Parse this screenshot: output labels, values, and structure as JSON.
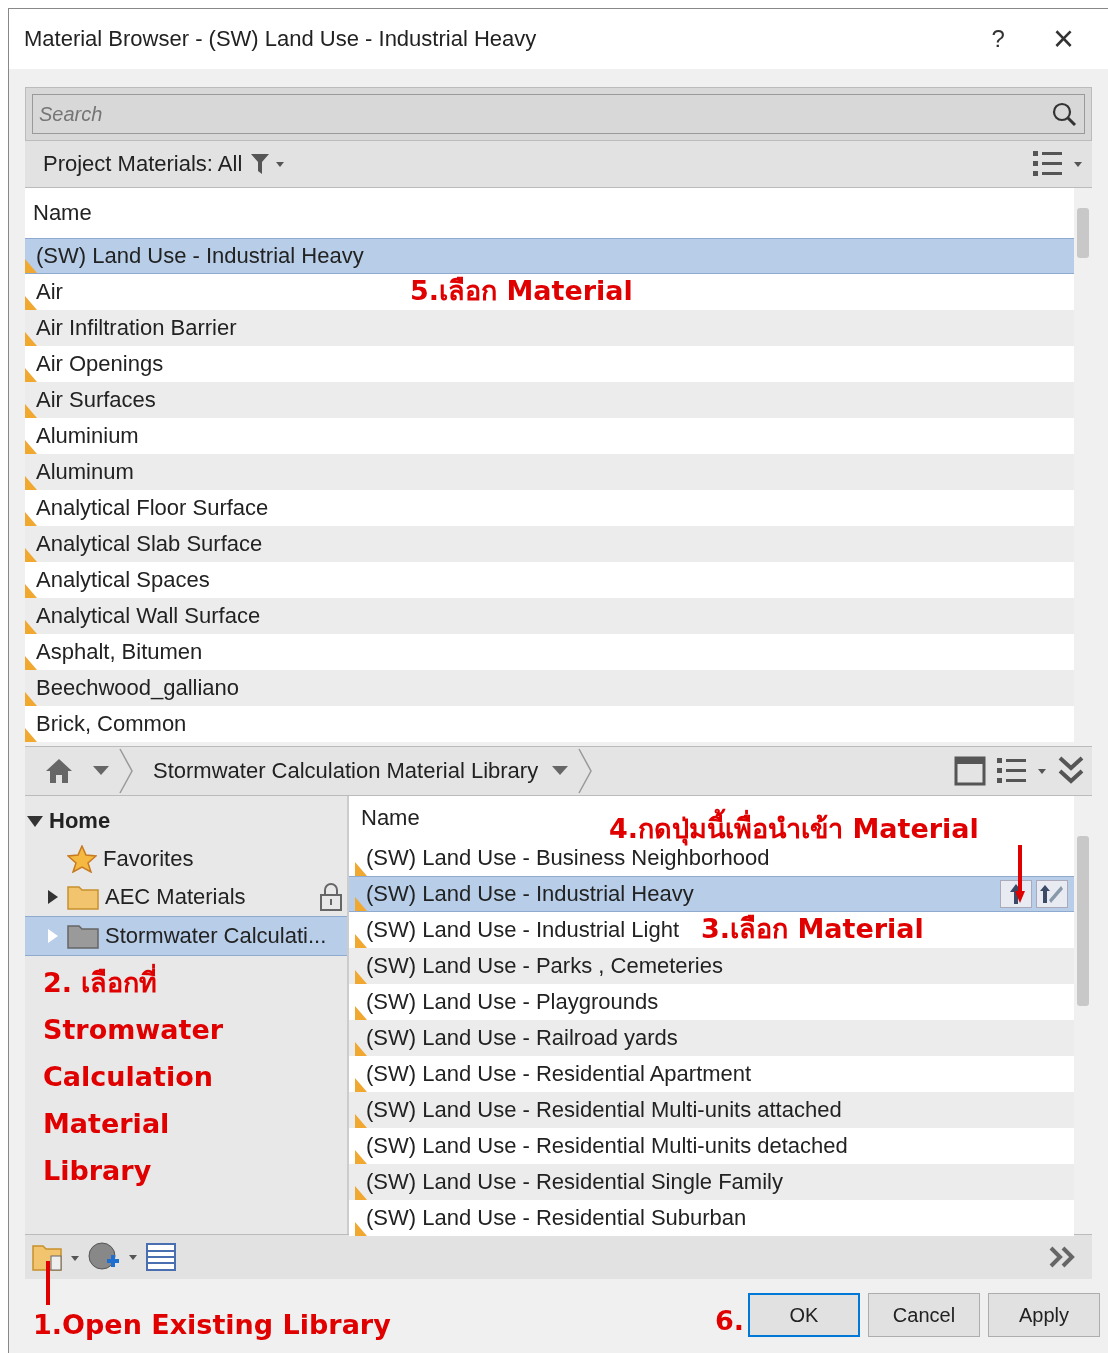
{
  "window": {
    "title": "Material Browser - (SW) Land Use - Industrial Heavy",
    "help": "?",
    "close": "×"
  },
  "search": {
    "placeholder": "Search"
  },
  "filter_bar": {
    "label": "Project Materials: All"
  },
  "project_materials": {
    "column": "Name",
    "rows": [
      {
        "name": "(SW) Land Use - Industrial Heavy",
        "selected": true
      },
      {
        "name": "Air",
        "selected": false
      },
      {
        "name": "Air Infiltration Barrier",
        "selected": false
      },
      {
        "name": "Air Openings",
        "selected": false
      },
      {
        "name": "Air Surfaces",
        "selected": false
      },
      {
        "name": "Aluminium",
        "selected": false
      },
      {
        "name": "Aluminum",
        "selected": false
      },
      {
        "name": "Analytical Floor Surface",
        "selected": false
      },
      {
        "name": "Analytical Slab Surface",
        "selected": false
      },
      {
        "name": "Analytical Spaces",
        "selected": false
      },
      {
        "name": "Analytical Wall Surface",
        "selected": false
      },
      {
        "name": "Asphalt, Bitumen",
        "selected": false
      },
      {
        "name": "Beechwood_galliano",
        "selected": false
      },
      {
        "name": "Brick, Common",
        "selected": false
      }
    ]
  },
  "library_bar": {
    "breadcrumb": "Stormwater Calculation Material Library"
  },
  "tree": [
    {
      "label": "Home",
      "kind": "home",
      "expanded": true,
      "selected": false,
      "children": [
        {
          "label": "Favorites",
          "kind": "favorites",
          "selected": false
        },
        {
          "label": "AEC Materials",
          "kind": "folder",
          "expanded": false,
          "locked": true,
          "selected": false
        },
        {
          "label": "Stormwater Calculati...",
          "kind": "folder",
          "expanded": false,
          "locked": false,
          "selected": true
        }
      ]
    }
  ],
  "library_materials": {
    "column": "Name",
    "rows": [
      {
        "name": "(SW) Land Use - Business Neighborhood",
        "selected": false
      },
      {
        "name": "(SW) Land Use - Industrial Heavy",
        "selected": true
      },
      {
        "name": "(SW) Land Use - Industrial Light",
        "selected": false
      },
      {
        "name": "(SW) Land Use - Parks , Cemeteries",
        "selected": false
      },
      {
        "name": "(SW) Land Use - Playgrounds",
        "selected": false
      },
      {
        "name": "(SW) Land Use - Railroad yards",
        "selected": false
      },
      {
        "name": "(SW) Land Use - Residential Apartment",
        "selected": false
      },
      {
        "name": "(SW) Land Use - Residential Multi-units attached",
        "selected": false
      },
      {
        "name": "(SW) Land Use - Residential Multi-units detached",
        "selected": false
      },
      {
        "name": "(SW) Land Use - Residential Single Family",
        "selected": false
      },
      {
        "name": "(SW) Land Use - Residential Suburban",
        "selected": false
      }
    ]
  },
  "buttons": [
    {
      "label": "OK",
      "selected": true
    },
    {
      "label": "Cancel",
      "selected": false
    },
    {
      "label": "Apply",
      "selected": false
    }
  ],
  "annotations": [
    {
      "lines": [
        "5.เลือก Material"
      ]
    },
    {
      "lines": [
        "4.กดปุ่มนี้เพื่อนำเข้า Material"
      ]
    },
    {
      "lines": [
        "3.เลือก Material"
      ]
    },
    {
      "lines": [
        "2. เลือกที่",
        "Stromwater",
        "Calculation",
        "Material",
        "Library"
      ]
    },
    {
      "lines": [
        "1.Open Existing Library"
      ]
    },
    {
      "lines": [
        "6."
      ]
    }
  ]
}
